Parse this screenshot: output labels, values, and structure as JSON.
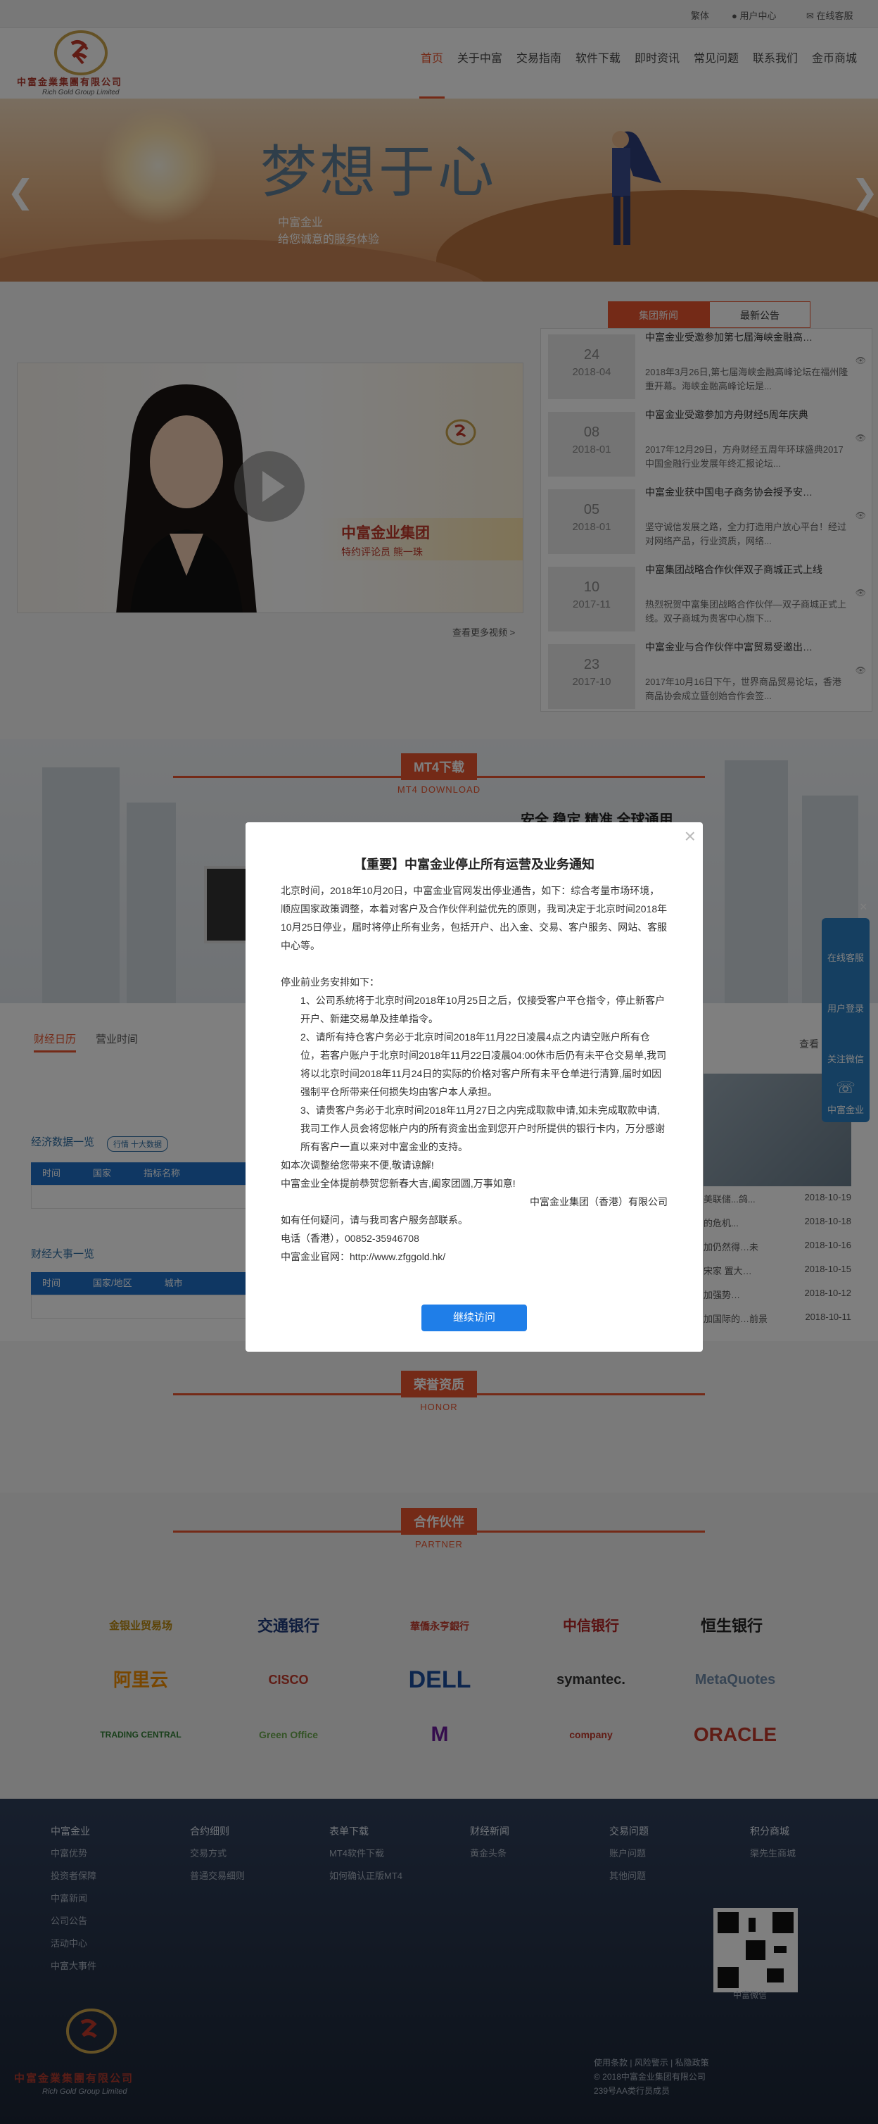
{
  "topbar": {
    "lang": "繁体",
    "user_center": "用户中心",
    "online_service": "在线客服"
  },
  "brand": {
    "name_cn": "中富金業集團有限公司",
    "name_en": "Rich Gold Group Limited"
  },
  "nav": [
    "首页",
    "关于中富",
    "交易指南",
    "软件下载",
    "即时资讯",
    "常见问题",
    "联系我们",
    "金币商城"
  ],
  "banner": {
    "title": "梦想于心",
    "sub1": "中富金业",
    "sub2": "给您诚意的服务体验"
  },
  "tabs": {
    "group_news": "集团新闻",
    "latest_notice": "最新公告"
  },
  "video": {
    "brand": "中富金业集团",
    "brand_sub": "特约评论员  熊一珠",
    "more": "查看更多视频 >"
  },
  "news": [
    {
      "day": "24",
      "month": "2018-04",
      "title": "中富金业受邀参加第七届海峡金融高…",
      "summary": "2018年3月26日,第七届海峡金融高峰论坛在福州隆重开幕。海峡金融高峰论坛是..."
    },
    {
      "day": "08",
      "month": "2018-01",
      "title": "中富金业受邀参加方舟财经5周年庆典",
      "summary": "2017年12月29日，方舟财经五周年环球盛典2017中国金融行业发展年终汇报论坛..."
    },
    {
      "day": "05",
      "month": "2018-01",
      "title": "中富金业获中国电子商务协会授予安…",
      "summary": "坚守诚信发展之路，全力打造用户放心平台！经过对网络产品，行业资质，网络..."
    },
    {
      "day": "10",
      "month": "2017-11",
      "title": "中富集团战略合作伙伴双子商城正式上线",
      "summary": "热烈祝贺中富集团战略合作伙伴—双子商城正式上线。双子商城为贵客中心旗下..."
    },
    {
      "day": "23",
      "month": "2017-10",
      "title": "中富金业与合作伙伴中富贸易受邀出…",
      "summary": "2017年10月16日下午，世界商品贸易论坛，香港商品协会成立暨创始合作会签..."
    }
  ],
  "mt4": {
    "badge": "MT4下载",
    "en": "MT4 DOWNLOAD",
    "slogan": "安全 稳定 精准 全球通用"
  },
  "data": {
    "tab_finance": "财经日历",
    "tab_hours": "营业时间",
    "more": "查看",
    "econ_title": "经济数据一览",
    "econ_badge": "行情 十大数据",
    "econ_cols": [
      "时间",
      "国家",
      "指标名称"
    ],
    "event_title": "财经大事一览",
    "event_cols": [
      "时间",
      "国家/地区",
      "城市"
    ],
    "side_items": [
      {
        "text": "美联储...鸽...",
        "date": "2018-10-19"
      },
      {
        "text": "的危机...",
        "date": "2018-10-18"
      },
      {
        "text": "加仍然得…未",
        "date": "2018-10-16"
      },
      {
        "text": "宋家 置大…",
        "date": "2018-10-15"
      },
      {
        "text": "加强势…",
        "date": "2018-10-12"
      },
      {
        "text": "加国际的…前景",
        "date": "2018-10-11"
      }
    ]
  },
  "honor": {
    "badge": "荣誉资质",
    "en": "HONOR"
  },
  "partner": {
    "badge": "合作伙伴",
    "en": "PARTNER",
    "logos": [
      "金银业贸易场",
      "交通银行",
      "華僑永亨銀行",
      "中信银行",
      "恒生银行",
      "阿里云",
      "CISCO",
      "DELL",
      "symantec.",
      "MetaQuotes",
      "TRADING CENTRAL",
      "Green Office",
      "M",
      "company",
      "ORACLE"
    ]
  },
  "footer": {
    "cols": [
      {
        "head": "中富金业",
        "items": [
          "中富优势",
          "投资者保障",
          "中富新闻",
          "公司公告",
          "活动中心",
          "中富大事件"
        ]
      },
      {
        "head": "合约细则",
        "items": [
          "交易方式",
          "普通交易细则"
        ]
      },
      {
        "head": "表单下载",
        "items": [
          "MT4软件下载",
          "如何确认正版MT4"
        ]
      },
      {
        "head": "财经新闻",
        "items": [
          "黄金头条"
        ]
      },
      {
        "head": "交易问题",
        "items": [
          "账户问题",
          "其他问题"
        ]
      },
      {
        "head": "积分商城",
        "items": [
          "渠先生商城"
        ]
      }
    ],
    "qr_label": "中富微信",
    "legal": "使用条款  |  风险警示  |  私隐政策",
    "copyright": "© 2018中富金业集团有限公司",
    "license": "239号AA类行员成员"
  },
  "side": {
    "close": "×",
    "items": [
      "在线客服",
      "用户登录",
      "关注微信",
      "中富金业"
    ]
  },
  "modal": {
    "title": "【重要】中富金业停止所有运营及业务通知",
    "p1": "北京时间，2018年10月20日，中富金业官网发出停业通告，如下：综合考量市场环境，顺应国家政策调整，本着对客户及合作伙伴利益优先的原则，我司决定于北京时间2018年10月25日停业，届时将停止所有业务，包括开户、出入金、交易、客户服务、网站、客服中心等。",
    "p2": "停业前业务安排如下：",
    "p3": "1、公司系统将于北京时间2018年10月25日之后，仅接受客户平仓指令，停止新客户开户、新建交易单及挂单指令。",
    "p4": "2、请所有持仓客户务必于北京时间2018年11月22日凌晨4点之内请空账户所有仓位，若客户账户于北京时间2018年11月22日凌晨04:00休市后仍有未平仓交易单,我司将以北京时间2018年11月24日的实际的价格对客户所有未平仓单进行清算,届时如因强制平仓所带来任何损失均由客户本人承担。",
    "p5": "3、请贵客户务必于北京时间2018年11月27日之内完成取款申请,如未完成取款申请,我司工作人员会将您帐户内的所有资金出金到您开户时所提供的银行卡内，万分感谢所有客户一直以来对中富金业的支持。",
    "p6": "如本次调整给您带来不便,敬请谅解!",
    "p7": "中富金业全体提前恭贺您新春大吉,阖家团圆,万事如意!",
    "p8": "中富金业集团（香港）有限公司",
    "p9": "如有任何疑问，请与我司客户服务部联系。",
    "p10": "电话（香港），00852-35946708",
    "p11": "中富金业官网：http://www.zfggold.hk/",
    "button": "继续访问",
    "close": "×"
  },
  "colors": {
    "accent": "#e8542e",
    "blue": "#1f7ee8",
    "footer": "#2f3f5b"
  }
}
